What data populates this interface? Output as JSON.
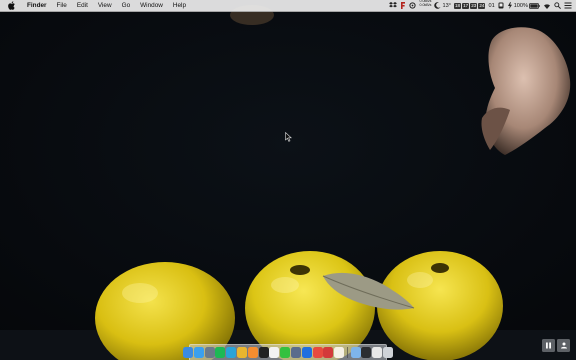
{
  "menubar": {
    "app_name": "Finder",
    "items": [
      "File",
      "Edit",
      "View",
      "Go",
      "Window",
      "Help"
    ],
    "network_up": "0.0kB/s",
    "network_down": "0.0kB/s",
    "temperature": "13°",
    "keyboard_badges": [
      "18",
      "17",
      "23",
      "24"
    ],
    "channel": "01",
    "battery_percent": "100%"
  },
  "dock": {
    "icons": [
      {
        "name": "finder-icon",
        "color": "#3b8be0"
      },
      {
        "name": "app-store-icon",
        "color": "#3aa0ee"
      },
      {
        "name": "launchpad-icon",
        "color": "#6b7a8a"
      },
      {
        "name": "spotify-icon",
        "color": "#1db954"
      },
      {
        "name": "telegram-icon",
        "color": "#2aa3d9"
      },
      {
        "name": "chrome-icon",
        "color": "#e9b52f"
      },
      {
        "name": "sublime-icon",
        "color": "#f58d2f"
      },
      {
        "name": "terminal-icon",
        "color": "#222222"
      },
      {
        "name": "books-icon",
        "color": "#f2f2f2"
      },
      {
        "name": "wechat-icon",
        "color": "#34c13f"
      },
      {
        "name": "screen-sharing-icon",
        "color": "#5a6c8c"
      },
      {
        "name": "1password-icon",
        "color": "#1f6fe0"
      },
      {
        "name": "mail-icon",
        "color": "#e84a3e"
      },
      {
        "name": "airmail-icon",
        "color": "#d33a3a"
      },
      {
        "name": "notes-icon",
        "color": "#f5f0e5"
      }
    ],
    "right_icons": [
      {
        "name": "folder-icon",
        "color": "#7eb4ea"
      },
      {
        "name": "window-icon",
        "color": "#2b2d31"
      },
      {
        "name": "screen-icon",
        "color": "#e8e8e8"
      },
      {
        "name": "trash-icon",
        "color": "#cfd3d8"
      }
    ]
  },
  "colors": {
    "quince_yellow": "#e8cf1e",
    "background": "#07090d"
  }
}
